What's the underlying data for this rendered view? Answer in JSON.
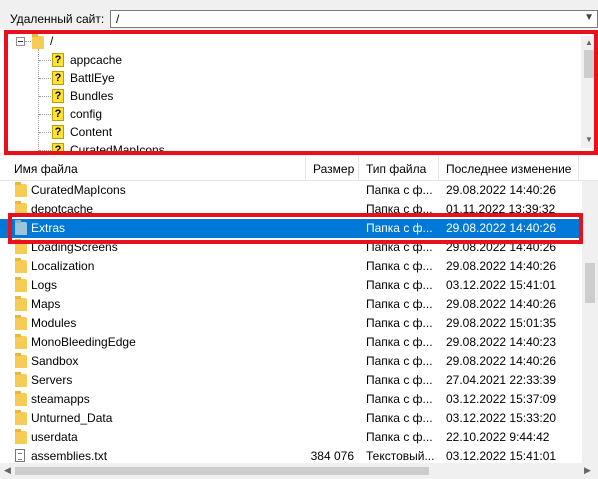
{
  "remote_site": {
    "label": "Удаленный сайт:",
    "path": "/"
  },
  "tree": {
    "root": "/",
    "items": [
      "appcache",
      "BattlEye",
      "Bundles",
      "config",
      "Content",
      "CuratedMapIcons"
    ]
  },
  "columns": {
    "name": "Имя файла",
    "size": "Размер",
    "type": "Тип файла",
    "modified": "Последнее изменение"
  },
  "files": [
    {
      "name": "CuratedMapIcons",
      "size": "",
      "type": "Папка с ф...",
      "modified": "29.08.2022 14:40:26",
      "icon": "folder"
    },
    {
      "name": "depotcache",
      "size": "",
      "type": "Папка с ф...",
      "modified": "01.11.2022 13:39:32",
      "icon": "folder"
    },
    {
      "name": "Extras",
      "size": "",
      "type": "Папка с ф...",
      "modified": "29.08.2022 14:40:26",
      "icon": "folder",
      "selected": true
    },
    {
      "name": "LoadingScreens",
      "size": "",
      "type": "Папка с ф...",
      "modified": "29.08.2022 14:40:26",
      "icon": "folder"
    },
    {
      "name": "Localization",
      "size": "",
      "type": "Папка с ф...",
      "modified": "29.08.2022 14:40:26",
      "icon": "folder"
    },
    {
      "name": "Logs",
      "size": "",
      "type": "Папка с ф...",
      "modified": "03.12.2022 15:41:01",
      "icon": "folder"
    },
    {
      "name": "Maps",
      "size": "",
      "type": "Папка с ф...",
      "modified": "29.08.2022 14:40:26",
      "icon": "folder"
    },
    {
      "name": "Modules",
      "size": "",
      "type": "Папка с ф...",
      "modified": "29.08.2022 15:01:35",
      "icon": "folder"
    },
    {
      "name": "MonoBleedingEdge",
      "size": "",
      "type": "Папка с ф...",
      "modified": "29.08.2022 14:40:23",
      "icon": "folder"
    },
    {
      "name": "Sandbox",
      "size": "",
      "type": "Папка с ф...",
      "modified": "29.08.2022 14:40:26",
      "icon": "folder"
    },
    {
      "name": "Servers",
      "size": "",
      "type": "Папка с ф...",
      "modified": "27.04.2021 22:33:39",
      "icon": "folder"
    },
    {
      "name": "steamapps",
      "size": "",
      "type": "Папка с ф...",
      "modified": "03.12.2022 15:37:09",
      "icon": "folder"
    },
    {
      "name": "Unturned_Data",
      "size": "",
      "type": "Папка с ф...",
      "modified": "03.12.2022 15:33:20",
      "icon": "folder"
    },
    {
      "name": "userdata",
      "size": "",
      "type": "Папка с ф...",
      "modified": "22.10.2022 9:44:42",
      "icon": "folder"
    },
    {
      "name": "assemblies.txt",
      "size": "384 076",
      "type": "Текстовый...",
      "modified": "03.12.2022 15:41:01",
      "icon": "file"
    }
  ],
  "colors": {
    "selection": "#0078d7",
    "highlight_box": "#e8101d",
    "folder": "#f7cc55",
    "unknown_icon": "#ffe233"
  }
}
